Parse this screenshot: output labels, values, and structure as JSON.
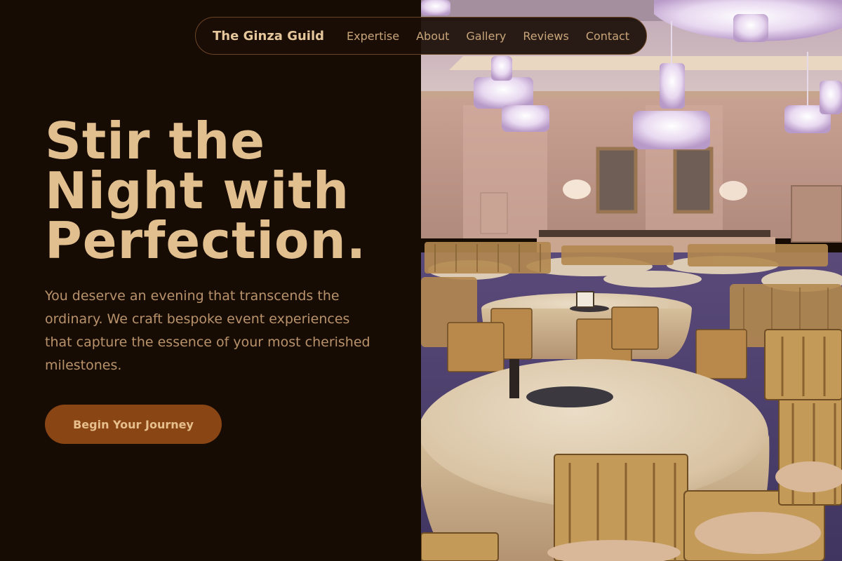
{
  "nav": {
    "brand": "The Ginza Guild",
    "links": [
      "Expertise",
      "About",
      "Gallery",
      "Reviews",
      "Contact"
    ]
  },
  "hero": {
    "headline_lines": [
      "Stir the",
      "Night with",
      "Perfection."
    ],
    "subtitle": "You deserve an evening that transcends the ordinary. We craft bespoke event experiences that capture the essence of your most cherished milestones.",
    "cta_label": "Begin Your Journey"
  },
  "image": {
    "subject": "ballroom-with-chandeliers-and-round-tables"
  },
  "colors": {
    "background": "#170c04",
    "headline": "#e2bf8f",
    "subtitle": "#b8926a",
    "cta_background": "#8a4515",
    "cta_text": "#e6bf8c",
    "nav_border": "#6b4424"
  }
}
